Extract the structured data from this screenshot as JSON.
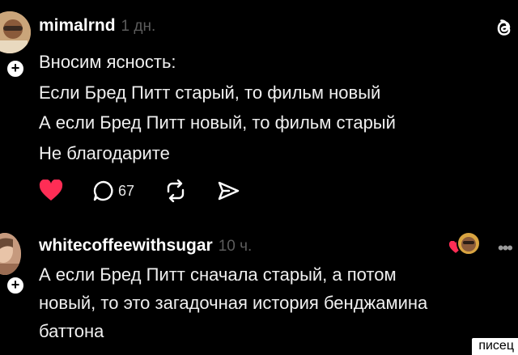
{
  "posts": [
    {
      "username": "mimalrnd",
      "timestamp": "1 дн.",
      "lines": [
        "Вносим ясность:",
        "Если Бред Питт старый, то фильм новый",
        "А если Бред Питт новый, то фильм старый",
        "Не благодарите"
      ],
      "actions": {
        "reply_count": "67"
      }
    },
    {
      "username": "whitecoffeewithsugar",
      "timestamp": "10 ч.",
      "lines": [
        "А если Бред Питт сначала старый, а потом",
        "новый, то это загадочная история бенджамина",
        "баттона"
      ]
    }
  ],
  "icons": {
    "like": "heart-icon",
    "reply": "speech-bubble-icon",
    "repost": "repost-icon",
    "share": "send-icon",
    "brand": "threads-logo",
    "more": "more-dots-icon"
  },
  "colors": {
    "like": "#ff2d55",
    "background": "#000000",
    "timestamp": "#5c5c5c"
  },
  "watermark": "писец"
}
